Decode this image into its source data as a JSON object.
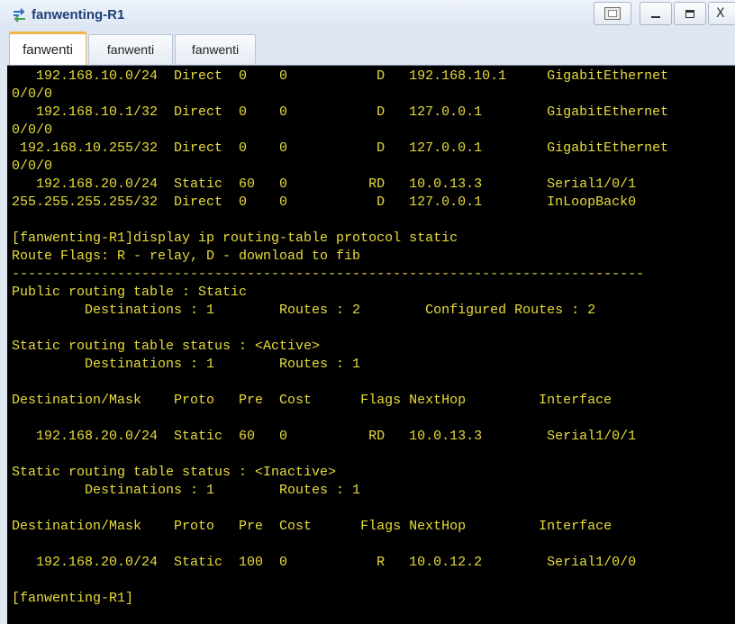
{
  "window": {
    "title": "fanwenting-R1",
    "close_label": "X"
  },
  "tabs": [
    {
      "label": "fanwenti",
      "active": true
    },
    {
      "label": "fanwenti",
      "active": false
    },
    {
      "label": "fanwenti",
      "active": false
    }
  ],
  "colors": {
    "console_bg": "#000000",
    "console_text": "#e8dc3c",
    "active_tab_accent": "#f0b64a",
    "title_text": "#1c3f77"
  },
  "console": {
    "lines": [
      "   192.168.10.0/24  Direct  0    0           D   192.168.10.1     GigabitEthernet",
      "0/0/0",
      "   192.168.10.1/32  Direct  0    0           D   127.0.0.1        GigabitEthernet",
      "0/0/0",
      " 192.168.10.255/32  Direct  0    0           D   127.0.0.1        GigabitEthernet",
      "0/0/0",
      "   192.168.20.0/24  Static  60   0          RD   10.0.13.3        Serial1/0/1",
      "255.255.255.255/32  Direct  0    0           D   127.0.0.1        InLoopBack0",
      "",
      "[fanwenting-R1]display ip routing-table protocol static",
      "Route Flags: R - relay, D - download to fib",
      "------------------------------------------------------------------------------",
      "Public routing table : Static",
      "         Destinations : 1        Routes : 2        Configured Routes : 2",
      "",
      "Static routing table status : <Active>",
      "         Destinations : 1        Routes : 1",
      "",
      "Destination/Mask    Proto   Pre  Cost      Flags NextHop         Interface",
      "",
      "   192.168.20.0/24  Static  60   0          RD   10.0.13.3        Serial1/0/1",
      "",
      "Static routing table status : <Inactive>",
      "         Destinations : 1        Routes : 1",
      "",
      "Destination/Mask    Proto   Pre  Cost      Flags NextHop         Interface",
      "",
      "   192.168.20.0/24  Static  100  0           R   10.0.12.2        Serial1/0/0",
      "",
      "[fanwenting-R1]"
    ]
  }
}
